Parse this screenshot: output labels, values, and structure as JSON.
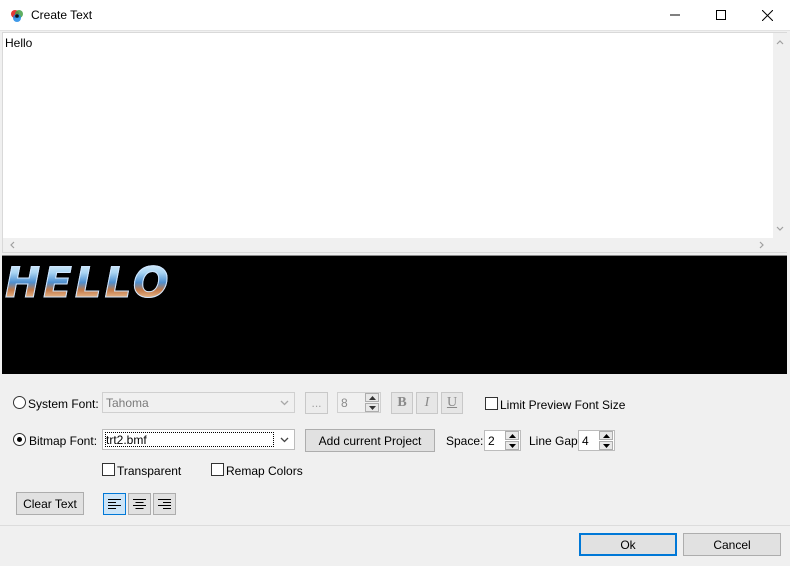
{
  "window": {
    "title": "Create Text",
    "icon": "rgb-circles-icon",
    "controls": [
      "minimize-icon",
      "maximize-icon",
      "close-icon"
    ]
  },
  "editor": {
    "text": "Hello"
  },
  "preview": {
    "text": "HELLO"
  },
  "system_font": {
    "label": "System Font:",
    "selected": false,
    "font_value": "Tahoma",
    "browse_label": "...",
    "size_value": "8",
    "bold_label": "B",
    "italic_label": "I",
    "underline_label": "U",
    "limit_preview_label": "Limit Preview Font Size",
    "limit_preview_checked": false
  },
  "bitmap_font": {
    "label": "Bitmap Font:",
    "selected": true,
    "font_value": "trt2.bmf",
    "add_project_label": "Add current Project",
    "space_label": "Space:",
    "space_value": "2",
    "line_gap_label": "Line Gap:",
    "line_gap_value": "4"
  },
  "options": {
    "transparent_label": "Transparent",
    "transparent_checked": false,
    "remap_label": "Remap Colors",
    "remap_checked": false
  },
  "actions": {
    "clear_label": "Clear Text",
    "align_selected": "left",
    "ok_label": "Ok",
    "cancel_label": "Cancel"
  },
  "colors": {
    "accent": "#0078d7",
    "preview_bg": "#000000"
  }
}
